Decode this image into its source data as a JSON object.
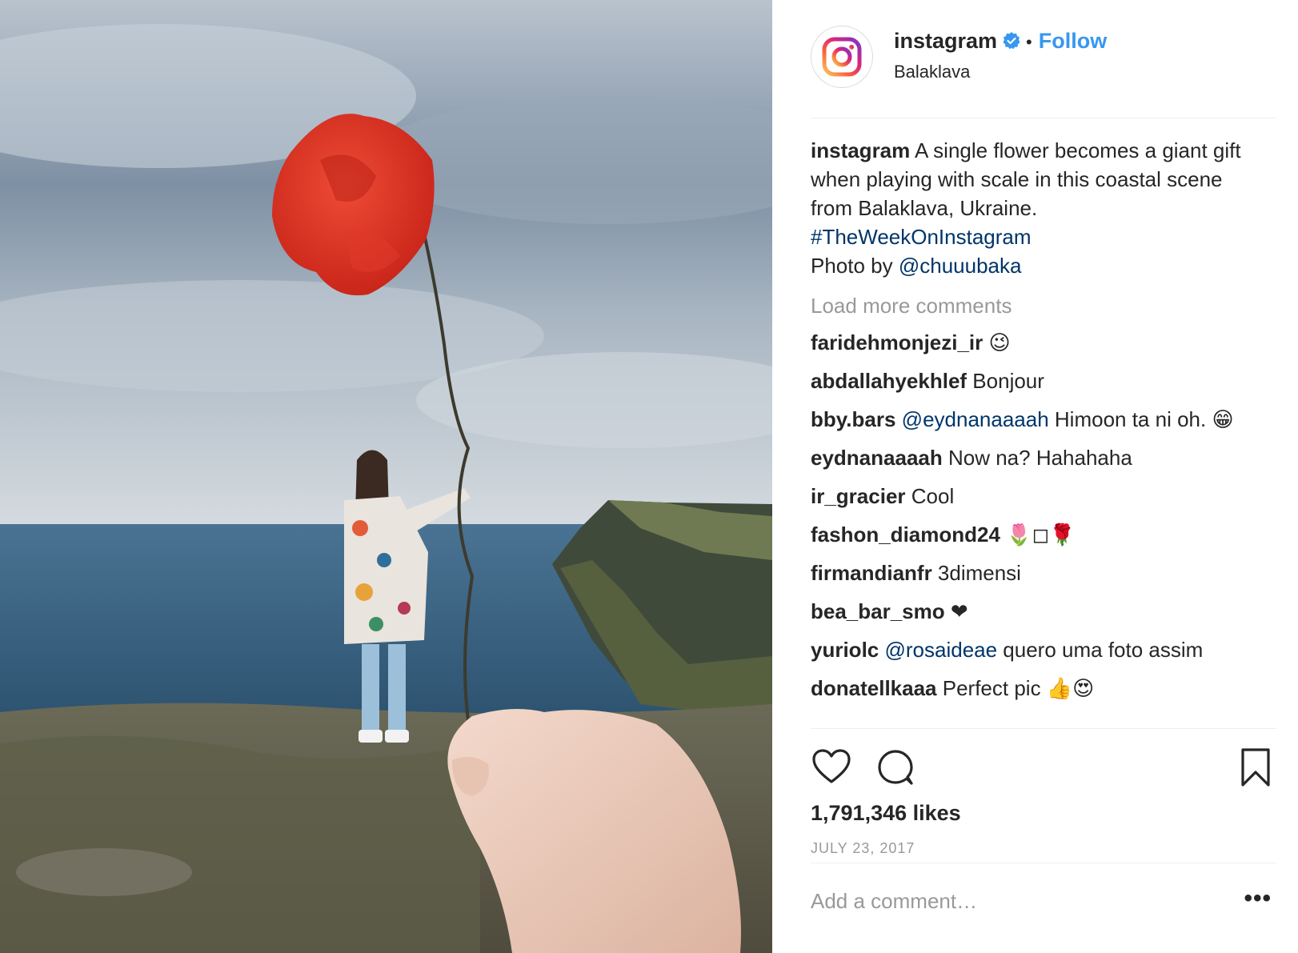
{
  "post": {
    "username": "instagram",
    "follow_label": "Follow",
    "separator": "•",
    "location": "Balaklava"
  },
  "caption": {
    "username": "instagram",
    "text": " A single flower becomes a giant gift when playing with scale in this coastal scene from Balaklava, Ukraine.",
    "hashtag": "#TheWeekOnInstagram",
    "photo_by_prefix": "Photo by ",
    "photo_by_handle": "@chuuubaka"
  },
  "load_more_label": "Load more comments",
  "comments": [
    {
      "user": "faridehmonjezi_ir",
      "text": " 😉"
    },
    {
      "user": "abdallahyekhlef",
      "text": " Bonjour"
    },
    {
      "user": "bby.bars",
      "mention": "@eydnanaaaah",
      "text": " Himoon ta ni oh. 😁"
    },
    {
      "user": "eydnanaaaah",
      "text": " Now na? Hahahaha"
    },
    {
      "user": "ir_gracier",
      "text": " Cool"
    },
    {
      "user": "fashon_diamond24",
      "text": " 🌷◻🌹"
    },
    {
      "user": "firmandianfr",
      "text": " 3dimensi"
    },
    {
      "user": "bea_bar_smo",
      "text": " ❤"
    },
    {
      "user": "yuriolc",
      "mention": "@rosaideae",
      "text": " quero uma foto assim"
    },
    {
      "user": "donatellkaaa",
      "text": " Perfect pic 👍😍"
    }
  ],
  "likes": "1,791,346 likes",
  "date": "JULY 23, 2017",
  "add_comment_placeholder": "Add a comment…",
  "more_label": "•••",
  "icons": {
    "like": "heart-icon",
    "comment": "comment-icon",
    "save": "bookmark-icon",
    "verified": "verified-badge-icon",
    "avatar": "instagram-logo-icon"
  },
  "colors": {
    "follow": "#3897f0",
    "link": "#003569",
    "muted": "#999999",
    "text": "#262626"
  }
}
